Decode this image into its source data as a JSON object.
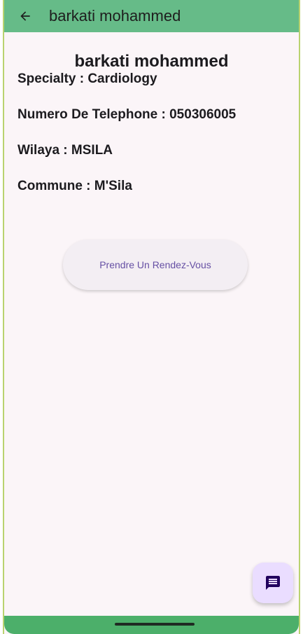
{
  "appbar": {
    "title": "barkati mohammed",
    "back_icon": "arrow-back-icon"
  },
  "doctor": {
    "name": "barkati mohammed",
    "specialty": "Specialty : Cardiology",
    "phone": "Numero De Telephone : 050306005",
    "wilaya": "Wilaya : MSILA",
    "commune": "Commune : M'Sila"
  },
  "actions": {
    "appointment_label": "Prendre Un Rendez-Vous",
    "chat_icon": "chat-message-icon"
  },
  "colors": {
    "appbar": "#66bb88",
    "background": "#fbf5f8",
    "button_text": "#6650a4",
    "fab": "#eaddff",
    "navbar": "#4caf6a"
  }
}
